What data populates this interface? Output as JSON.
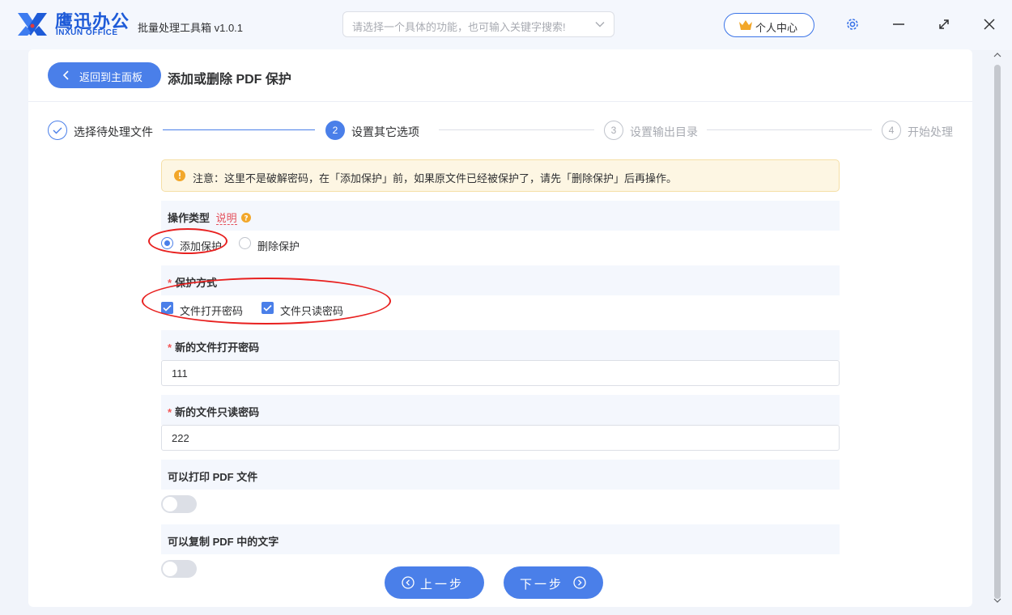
{
  "app": {
    "brand_cn": "鹰迅办公",
    "brand_en": "INXUN OFFICE",
    "name": "批量处理工具箱 v1.0.1",
    "search_placeholder": "请选择一个具体的功能，也可输入关键字搜索!",
    "user_center": "个人中心"
  },
  "colors": {
    "primary": "#4a7fe9",
    "brand": "#1e5bd8",
    "warning": "#f2a72a",
    "annotation": "#e8201f"
  },
  "header": {
    "back_label": "返回到主面板",
    "page_title": "添加或删除 PDF 保护"
  },
  "steps": [
    {
      "num": "✓",
      "label": "选择待处理文件",
      "state": "done"
    },
    {
      "num": "2",
      "label": "设置其它选项",
      "state": "active"
    },
    {
      "num": "3",
      "label": "设置输出目录",
      "state": "wait"
    },
    {
      "num": "4",
      "label": "开始处理",
      "state": "wait"
    }
  ],
  "notice": "注意：这里不是破解密码，在「添加保护」前，如果原文件已经被保护了，请先「删除保护」后再操作。",
  "form": {
    "op_type": {
      "label": "操作类型",
      "explain": "说明",
      "options": [
        {
          "label": "添加保护",
          "selected": true
        },
        {
          "label": "删除保护",
          "selected": false
        }
      ]
    },
    "protect_mode": {
      "required_mark": "*",
      "label": "保护方式",
      "options": [
        {
          "label": "文件打开密码",
          "checked": true
        },
        {
          "label": "文件只读密码",
          "checked": true
        }
      ]
    },
    "open_password": {
      "required_mark": "*",
      "label": "新的文件打开密码",
      "value": "111"
    },
    "readonly_password": {
      "required_mark": "*",
      "label": "新的文件只读密码",
      "value": "222"
    },
    "can_print": {
      "label": "可以打印 PDF 文件",
      "on": false
    },
    "can_copy": {
      "label": "可以复制 PDF 中的文字",
      "on": false
    }
  },
  "nav": {
    "prev": "上一步",
    "next": "下一步"
  }
}
